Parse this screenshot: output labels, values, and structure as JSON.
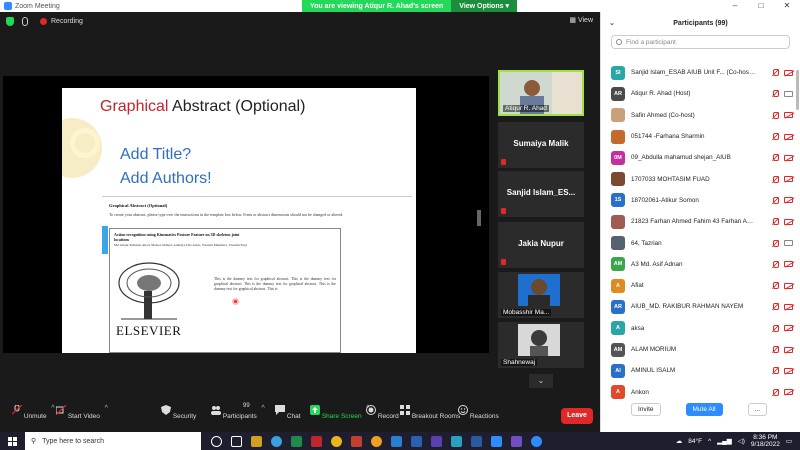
{
  "window": {
    "title": "Zoom Meeting",
    "banner": "You are viewing Atiqur R. Ahad's screen",
    "view_options": "View Options",
    "controls": [
      "–",
      "□",
      "✕"
    ]
  },
  "meeting_bar": {
    "recording_label": "Recording",
    "view_label": "View"
  },
  "slide": {
    "title_red": "Graphical",
    "title_rest": " Abstract (Optional)",
    "sub1": "Add Title?",
    "sub2": "Add Authors!",
    "doc_heading": "Graphical Abstract (Optional)",
    "doc_instructions": "To create your abstract, please type over the instructions in the template box below. Fonts or abstract dimensions should not be changed or altered.",
    "box_title": "Action recognition using Kinematics Posture Feature on 3D skeleton joint locations",
    "box_authors": "Md Atiqur Rahman Ahad, Masud Ahmed, Anindya Das Antar, Yasushi Makihara, Yasushi Yagi",
    "publisher": "ELSEVIER",
    "dummy": "This is the dummy text for graphical abstract. This is the dummy text for graphical abstract. This is the dummy text for graphical abstract. This is the dummy text for graphical abstract. This is"
  },
  "video_tiles": [
    {
      "name": "Atiqur R. Ahad",
      "type": "video"
    },
    {
      "name": "Sumaiya Malik",
      "type": "name"
    },
    {
      "name": "Sanjid  Islam_ES...",
      "type": "name"
    },
    {
      "name": "Jakia Nupur",
      "type": "name"
    },
    {
      "name": "Mobasshir Ma...",
      "type": "photo"
    },
    {
      "name": "Shahnewaj",
      "type": "photo"
    }
  ],
  "toolbar": {
    "unmute": "Unmute",
    "start_video": "Start Video",
    "security": "Security",
    "participants": "Participants",
    "participants_count": "99",
    "chat": "Chat",
    "share_screen": "Share Screen",
    "record": "Record",
    "breakout": "Breakout Rooms",
    "reactions": "Reactions",
    "leave": "Leave"
  },
  "panel": {
    "title": "Participants (99)",
    "search_placeholder": "Find a participant",
    "invite": "Invite",
    "mute_all": "Mute All",
    "more": "...",
    "participants": [
      {
        "initials": "SI",
        "color": "#2aa6a6",
        "name": "Sanjid Islam_ESAB AIUB Unit F...  (Co-host, me)",
        "video": true
      },
      {
        "initials": "AR",
        "color": "#4a4a4a",
        "name": "Atiqur R. Ahad (Host)",
        "video": false
      },
      {
        "initials": "",
        "color": "#caa07a",
        "name": "Safin Ahmed (Co-host)",
        "video": true
      },
      {
        "initials": "",
        "color": "#c46b2b",
        "name": "051744 -Farhana Sharmin",
        "video": true
      },
      {
        "initials": "0M",
        "color": "#c030a0",
        "name": "09_Abdulla mahamud shejan_AIUB",
        "video": true
      },
      {
        "initials": "",
        "color": "#7a4a30",
        "name": "1707033 MOHTASIM FUAD",
        "video": true
      },
      {
        "initials": "1S",
        "color": "#2a70c8",
        "name": "18702061-Atikur Somon",
        "video": true
      },
      {
        "initials": "",
        "color": "#a05a50",
        "name": "21823 Farhan Ahmed Fahim 43 Farhan Ahme...",
        "video": true
      },
      {
        "initials": "",
        "color": "#556070",
        "name": "64, Tazrian",
        "video": false
      },
      {
        "initials": "AM",
        "color": "#3aa54a",
        "name": "A3 Md. Asif Adnan",
        "video": true
      },
      {
        "initials": "A",
        "color": "#e08a20",
        "name": "Afiat",
        "video": true
      },
      {
        "initials": "AR",
        "color": "#2a70c8",
        "name": "AIUB_MD. RAKIBUR RAHMAN NAYEM",
        "video": true
      },
      {
        "initials": "A",
        "color": "#2aa6a6",
        "name": "aksa",
        "video": true
      },
      {
        "initials": "AM",
        "color": "#555555",
        "name": "ALAM MORIUM",
        "video": true
      },
      {
        "initials": "AI",
        "color": "#2a70c8",
        "name": "AMINUL ISALM",
        "video": true
      },
      {
        "initials": "A",
        "color": "#e04a2a",
        "name": "Ankon",
        "video": true
      }
    ]
  },
  "taskbar": {
    "search_placeholder": "Type here to search",
    "temperature": "84°F",
    "time": "8:36 PM",
    "date": "9/18/2022"
  }
}
